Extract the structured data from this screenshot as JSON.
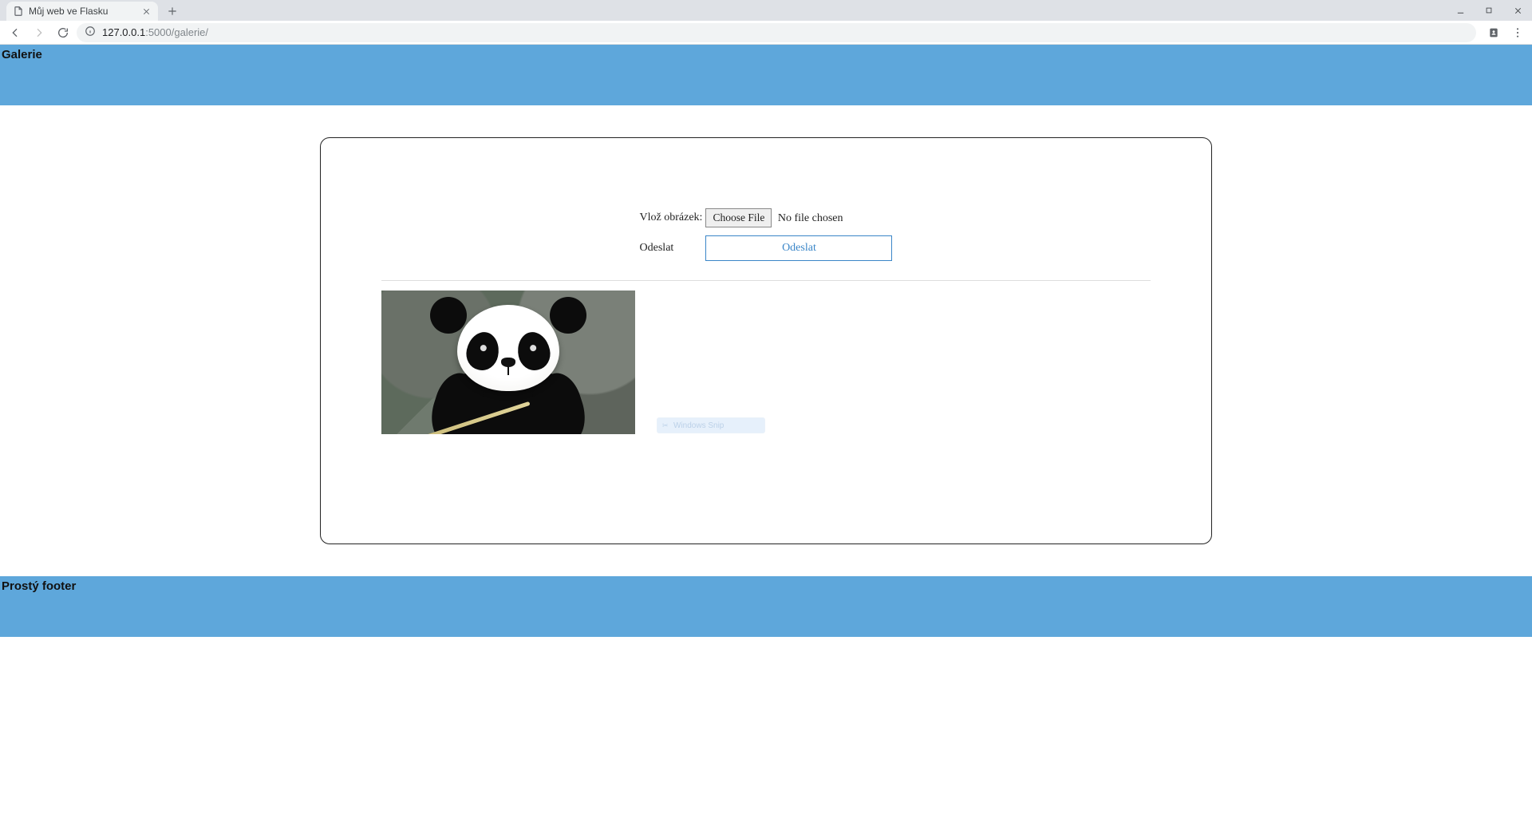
{
  "browser": {
    "tab_title": "Můj web ve Flasku",
    "url_host": "127.0.0.1",
    "url_port": ":5000",
    "url_path": "/galerie/"
  },
  "page": {
    "header_title": "Galerie",
    "footer_text": "Prostý footer",
    "form": {
      "file_label": "Vlož obrázek:",
      "choose_file_button": "Choose File",
      "no_file_text": "No file chosen",
      "submit_label_row": "Odeslat",
      "submit_button": "Odeslat"
    },
    "gallery": {
      "images": [
        {
          "alt": "panda"
        }
      ]
    },
    "snip_overlay": "Windows Snip"
  },
  "colors": {
    "accent_blue": "#5ea7db",
    "button_border": "#3a86c8"
  }
}
